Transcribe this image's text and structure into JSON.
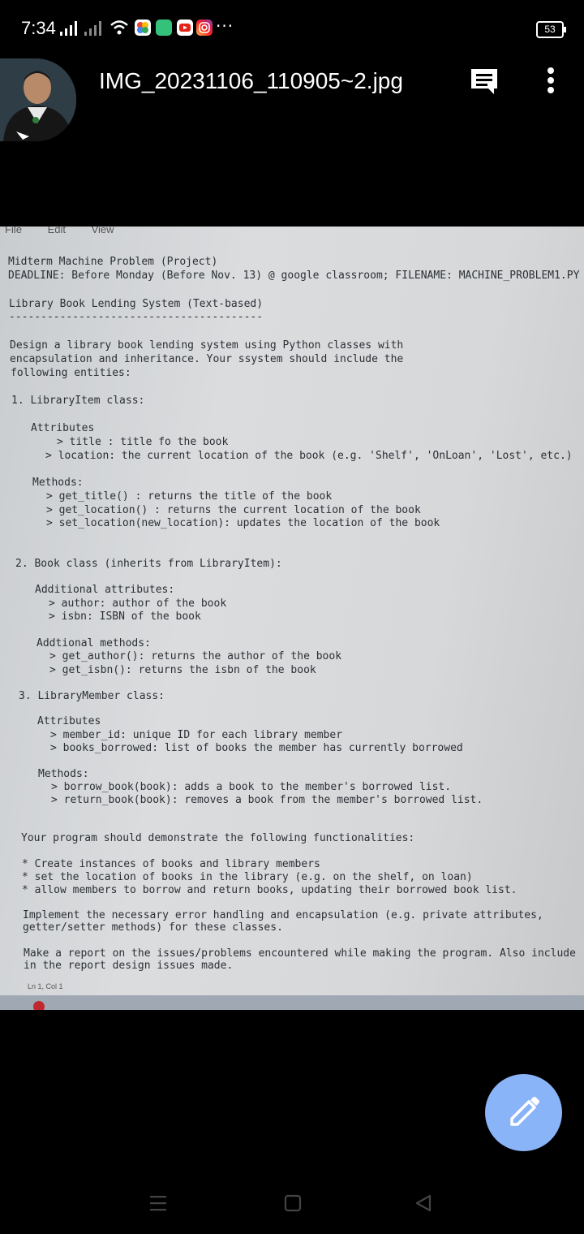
{
  "status_bar": {
    "time": "7:34",
    "battery": "53",
    "more": "···"
  },
  "header": {
    "title": "IMG_20231106_110905~2.jpg",
    "icons": [
      "avatar",
      "comment-icon",
      "more-vert-icon"
    ]
  },
  "photo": {
    "menu": [
      "File",
      "Edit",
      "View"
    ],
    "lines": [
      "Midterm Machine Problem (Project)",
      "DEADLINE: Before Monday (Before Nov. 13) @ google classroom; FILENAME: MACHINE_PROBLEM1.PY",
      "Library Book Lending System (Text-based)",
      "----------------------------------------",
      "Design a library book lending system using Python classes with",
      "encapsulation and inheritance. Your ssystem should include the",
      "following entities:",
      "1. LibraryItem class:",
      "Attributes",
      "> title : title fo the book",
      "> location: the current location of the book (e.g. 'Shelf', 'OnLoan', 'Lost', etc.)",
      "Methods:",
      "> get_title() : returns the title of the book",
      "> get_location() : returns the current location of the book",
      "> set_location(new_location): updates the location of the book",
      "2. Book class (inherits from LibraryItem):",
      "Additional attributes:",
      "> author: author of the book",
      "> isbn: ISBN of the book",
      "Addtional methods:",
      "> get_author(): returns the author of the book",
      "> get_isbn(): returns the isbn of the book",
      "3. LibraryMember class:",
      "Attributes",
      "> member_id: unique ID for each library member",
      "> books_borrowed: list of books the member has currently borrowed",
      "Methods:",
      "> borrow_book(book): adds a book to the member's borrowed list.",
      "> return_book(book): removes a book from the member's borrowed list.",
      "Your program should demonstrate the following functionalities:",
      "* Create instances of books and library members",
      "* set the location of books in the library (e.g. on the shelf, on loan)",
      "* allow members to borrow and return books, updating their borrowed book list.",
      "Implement the necessary error handling and encapsulation (e.g. private attributes,",
      "getter/setter methods) for these classes.",
      "Make a report on the issues/problems encountered while making the program. Also include",
      "in the report design issues made."
    ],
    "status_line": "Ln 1, Col 1"
  }
}
